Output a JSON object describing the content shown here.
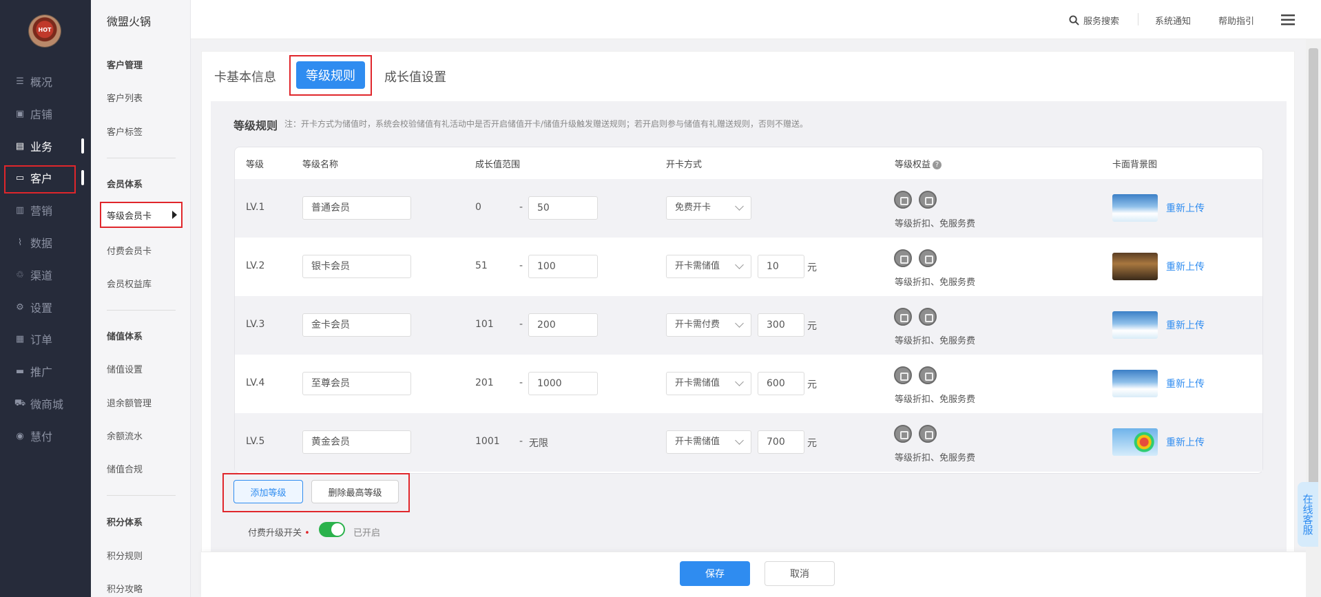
{
  "logo": {
    "text": "HOT"
  },
  "nav": [
    {
      "icon": "list-icon",
      "glyph": "☰",
      "label": "概况"
    },
    {
      "icon": "store-icon",
      "glyph": "▣",
      "label": "店铺"
    },
    {
      "icon": "briefcase-icon",
      "glyph": "▤",
      "label": "业务"
    },
    {
      "icon": "card-icon",
      "glyph": "▭",
      "label": "客户"
    },
    {
      "icon": "bar-chart-icon",
      "glyph": "▥",
      "label": "营销"
    },
    {
      "icon": "trend-icon",
      "glyph": "⌇",
      "label": "数据"
    },
    {
      "icon": "channel-icon",
      "glyph": "♲",
      "label": "渠道"
    },
    {
      "icon": "gear-icon",
      "glyph": "⚙",
      "label": "设置"
    },
    {
      "icon": "order-icon",
      "glyph": "▦",
      "label": "订单"
    },
    {
      "icon": "promote-icon",
      "glyph": "▬",
      "label": "推广"
    },
    {
      "icon": "cart-icon",
      "glyph": "⛟",
      "label": "微商城"
    },
    {
      "icon": "pay-icon",
      "glyph": "◉",
      "label": "慧付"
    }
  ],
  "app_name": "微盟火锅",
  "subnav": {
    "section1": "客户管理",
    "items1": [
      "客户列表",
      "客户标签"
    ],
    "section2": "会员体系",
    "active": "等级会员卡",
    "items2": [
      "付费会员卡",
      "会员权益库"
    ],
    "section3": "储值体系",
    "items3": [
      "储值设置",
      "退余额管理",
      "余额流水",
      "储值合规"
    ],
    "section4": "积分体系",
    "items4": [
      "积分规则",
      "积分攻略"
    ]
  },
  "topbar": {
    "search": "服务搜索",
    "notice": "系统通知",
    "help": "帮助指引"
  },
  "tabs": [
    "卡基本信息",
    "等级规则",
    "成长值设置"
  ],
  "panel": {
    "title": "等级规则",
    "note": "注：开卡方式为储值时，系统会校验储值有礼活动中是否开启储值开卡/储值升级触发赠送规则；若开启则参与储值有礼赠送规则，否则不赠送。"
  },
  "table": {
    "headers": [
      "等级",
      "等级名称",
      "成长值范围",
      "开卡方式",
      "等级权益",
      "卡面背景图"
    ],
    "help_icon": "?",
    "rows": [
      {
        "level": "LV.1",
        "name": "普通会员",
        "min": "0",
        "dash": "-",
        "max": "50",
        "method": "免费开卡",
        "amount": "",
        "unit": "",
        "benefits": "等级折扣、免服务费",
        "bg": "sky",
        "reupload": "重新上传"
      },
      {
        "level": "LV.2",
        "name": "银卡会员",
        "min": "51",
        "dash": "-",
        "max": "100",
        "method": "开卡需储值",
        "amount": "10",
        "unit": "元",
        "benefits": "等级折扣、免服务费",
        "bg": "crowd",
        "reupload": "重新上传"
      },
      {
        "level": "LV.3",
        "name": "金卡会员",
        "min": "101",
        "dash": "-",
        "max": "200",
        "method": "开卡需付费",
        "amount": "300",
        "unit": "元",
        "benefits": "等级折扣、免服务费",
        "bg": "sky",
        "reupload": "重新上传"
      },
      {
        "level": "LV.4",
        "name": "至尊会员",
        "min": "201",
        "dash": "-",
        "max": "1000",
        "method": "开卡需储值",
        "amount": "600",
        "unit": "元",
        "benefits": "等级折扣、免服务费",
        "bg": "sky",
        "reupload": "重新上传"
      },
      {
        "level": "LV.5",
        "name": "黄金会员",
        "min": "1001",
        "dash": "-",
        "max_text": "无限",
        "method": "开卡需储值",
        "amount": "700",
        "unit": "元",
        "benefits": "等级折扣、免服务费",
        "bg": "balloon",
        "reupload": "重新上传"
      }
    ]
  },
  "actions": {
    "add_level": "添加等级",
    "delete_highest": "删除最高等级"
  },
  "paid_upgrade": {
    "label": "付费升级开关",
    "required_mark": "•",
    "status": "已开启"
  },
  "footer": {
    "save": "保存",
    "cancel": "取消"
  },
  "support": "在线客服",
  "colors": {
    "primary": "#2f8cf0",
    "nav_bg": "#262b3a",
    "highlight": "#e0262b",
    "toggle_on": "#2bb24c"
  }
}
